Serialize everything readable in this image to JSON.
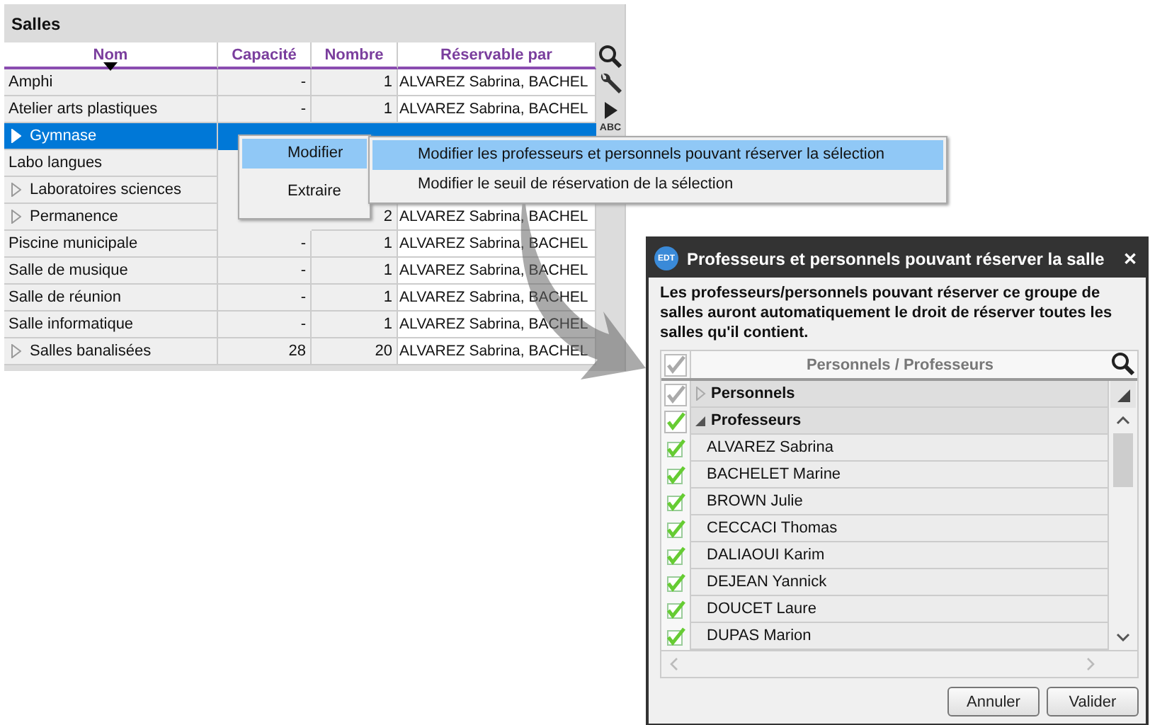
{
  "salles": {
    "title": "Salles",
    "columns": [
      "Nom",
      "Capacité",
      "Nombre",
      "Réservable par"
    ],
    "abc_label": "ABC",
    "rows": [
      {
        "name": "Amphi",
        "expandable": false,
        "selected": false,
        "capacity": "-",
        "count": "1",
        "reservable": "ALVAREZ Sabrina, BACHEL"
      },
      {
        "name": "Atelier arts plastiques",
        "expandable": false,
        "selected": false,
        "capacity": "-",
        "count": "1",
        "reservable": "ALVAREZ Sabrina, BACHEL"
      },
      {
        "name": "Gymnase",
        "expandable": true,
        "selected": true
      },
      {
        "name": "Labo langues",
        "expandable": false,
        "selected": false
      },
      {
        "name": "Laboratoires sciences",
        "expandable": true,
        "selected": false
      },
      {
        "name": "Permanence",
        "expandable": true,
        "selected": false,
        "count": "2",
        "reservable": "ALVAREZ Sabrina, BACHEL"
      },
      {
        "name": "Piscine municipale",
        "expandable": false,
        "selected": false,
        "capacity": "-",
        "count": "1",
        "reservable": "ALVAREZ Sabrina, BACHEL"
      },
      {
        "name": "Salle de musique",
        "expandable": false,
        "selected": false,
        "capacity": "-",
        "count": "1",
        "reservable": "ALVAREZ Sabrina, BACHEL"
      },
      {
        "name": "Salle de réunion",
        "expandable": false,
        "selected": false,
        "capacity": "-",
        "count": "1",
        "reservable": "ALVAREZ Sabrina, BACHEL"
      },
      {
        "name": "Salle informatique",
        "expandable": false,
        "selected": false,
        "capacity": "-",
        "count": "1",
        "reservable": "ALVAREZ Sabrina, BACHEL"
      },
      {
        "name": "Salles banalisées",
        "expandable": true,
        "selected": false,
        "capacity": "28",
        "count": "20",
        "reservable": "ALVAREZ Sabrina, BACHEL"
      }
    ]
  },
  "context_menu": {
    "items": [
      {
        "label": "Modifier",
        "selected": true
      },
      {
        "label": "Extraire",
        "selected": false
      }
    ],
    "submenu": [
      {
        "label": "Modifier les professeurs et personnels pouvant réserver la sélection",
        "selected": true
      },
      {
        "label": "Modifier le seuil de réservation de la sélection",
        "selected": false
      }
    ]
  },
  "dialog": {
    "title": "Professeurs et personnels pouvant réserver la salle",
    "logo": "EDT",
    "close": "✕",
    "description": "Les professeurs/personnels pouvant réserver ce groupe de salles auront automatiquement le droit de réserver toutes les salles qu'il contient.",
    "column": "Personnels / Professeurs",
    "header_check": {
      "checked": true,
      "dimmed": true
    },
    "groups": [
      {
        "label": "Personnels",
        "expanded": false,
        "checked": true,
        "dimmed": true
      },
      {
        "label": "Professeurs",
        "expanded": true,
        "checked": true,
        "dimmed": false
      }
    ],
    "people": [
      {
        "name": "ALVAREZ Sabrina",
        "checked": true
      },
      {
        "name": "BACHELET Marine",
        "checked": true
      },
      {
        "name": "BROWN Julie",
        "checked": true
      },
      {
        "name": "CECCACI Thomas",
        "checked": true
      },
      {
        "name": "DALIAOUI Karim",
        "checked": true
      },
      {
        "name": "DEJEAN Yannick",
        "checked": true
      },
      {
        "name": "DOUCET Laure",
        "checked": true
      },
      {
        "name": "DUPAS Marion",
        "checked": true
      }
    ],
    "buttons": [
      "Annuler",
      "Valider"
    ]
  }
}
